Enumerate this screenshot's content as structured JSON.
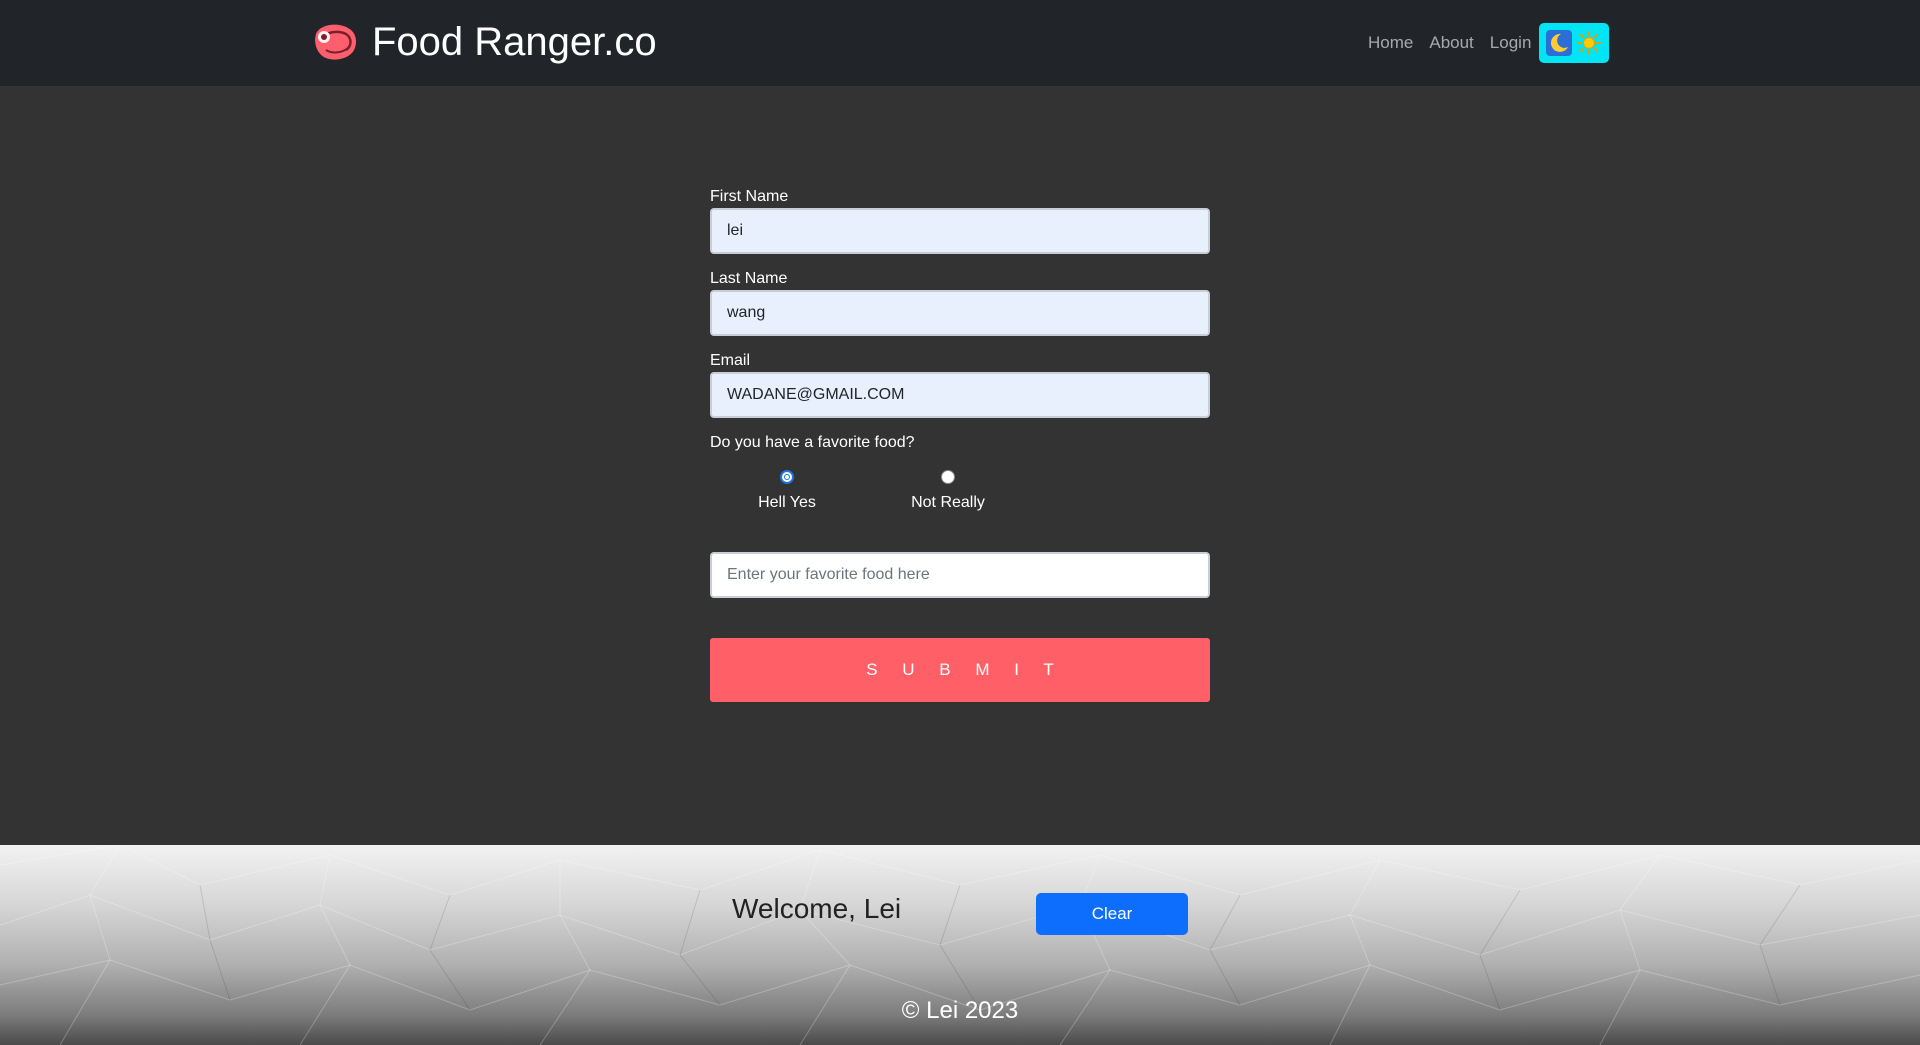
{
  "navbar": {
    "brand": "Food Ranger.co",
    "links": [
      "Home",
      "About",
      "Login"
    ],
    "theme_toggle": {
      "dark_icon": "moon-icon",
      "light_icon": "sun-icon",
      "background": "#00e5f5"
    }
  },
  "form": {
    "first_name": {
      "label": "First Name",
      "value": "lei"
    },
    "last_name": {
      "label": "Last Name",
      "value": "wang"
    },
    "email": {
      "label": "Email",
      "value": "WADANE@GMAIL.COM"
    },
    "question": "Do you have a favorite food?",
    "options": [
      {
        "label": "Hell Yes",
        "checked": true
      },
      {
        "label": "Not Really",
        "checked": false
      }
    ],
    "favorite_food": {
      "placeholder": "Enter your favorite food here",
      "value": ""
    },
    "submit_label": "S U B M I T",
    "submit_color": "#ff5f67"
  },
  "footer": {
    "welcome": "Welcome, Lei",
    "clear_label": "Clear",
    "clear_color": "#0d6efd",
    "copyright": "© Lei 2023"
  }
}
